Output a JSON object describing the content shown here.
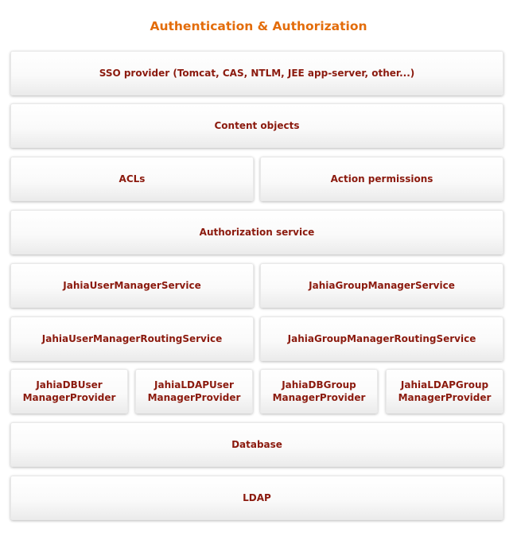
{
  "title": "Authentication & Authorization",
  "layers": {
    "sso": "SSO provider (Tomcat, CAS, NTLM, JEE app-server, other...)",
    "content_objects": "Content objects",
    "acls": "ACLs",
    "action_permissions": "Action permissions",
    "authorization_service": "Authorization service",
    "user_manager_service": "JahiaUserManagerService",
    "group_manager_service": "JahiaGroupManagerService",
    "user_manager_routing": "JahiaUserManagerRoutingService",
    "group_manager_routing": "JahiaGroupManagerRoutingService",
    "db_user_provider": [
      "JahiaDBUser",
      "ManagerProvider"
    ],
    "ldap_user_provider": [
      "JahiaLDAPUser",
      "ManagerProvider"
    ],
    "db_group_provider": [
      "JahiaDBGroup",
      "ManagerProvider"
    ],
    "ldap_group_provider": [
      "JahiaLDAPGroup",
      "ManagerProvider"
    ],
    "database": "Database",
    "ldap": "LDAP"
  },
  "colors": {
    "title": "#e36c0a",
    "box_text": "#8b1a0e"
  }
}
